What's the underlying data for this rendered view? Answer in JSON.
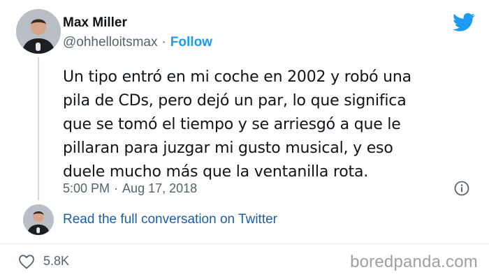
{
  "tweet": {
    "author_name": "Max Miller",
    "handle": "@ohhelloitsmax",
    "separator": "·",
    "follow_label": "Follow",
    "lines": [
      "Un tipo entró en mi coche en 2002 y robó una",
      "pila de CDs, pero dejó un par, lo que significa",
      "que se tomó el tiempo y se arriesgó a que le",
      "pillaran para juzgar mi gusto musical, y eso",
      "duele mucho más que la ventanilla rota."
    ],
    "time": "5:00 PM",
    "date": "Aug 17, 2018",
    "read_more": "Read the full conversation on Twitter",
    "likes": "5.8K"
  },
  "watermark": "boredpanda.com",
  "colors": {
    "accent": "#1d9bf0",
    "link": "#1d5ea8",
    "muted": "#536471",
    "text": "#0f1419"
  },
  "icons": [
    "twitter-bird-icon",
    "info-icon",
    "heart-icon"
  ]
}
